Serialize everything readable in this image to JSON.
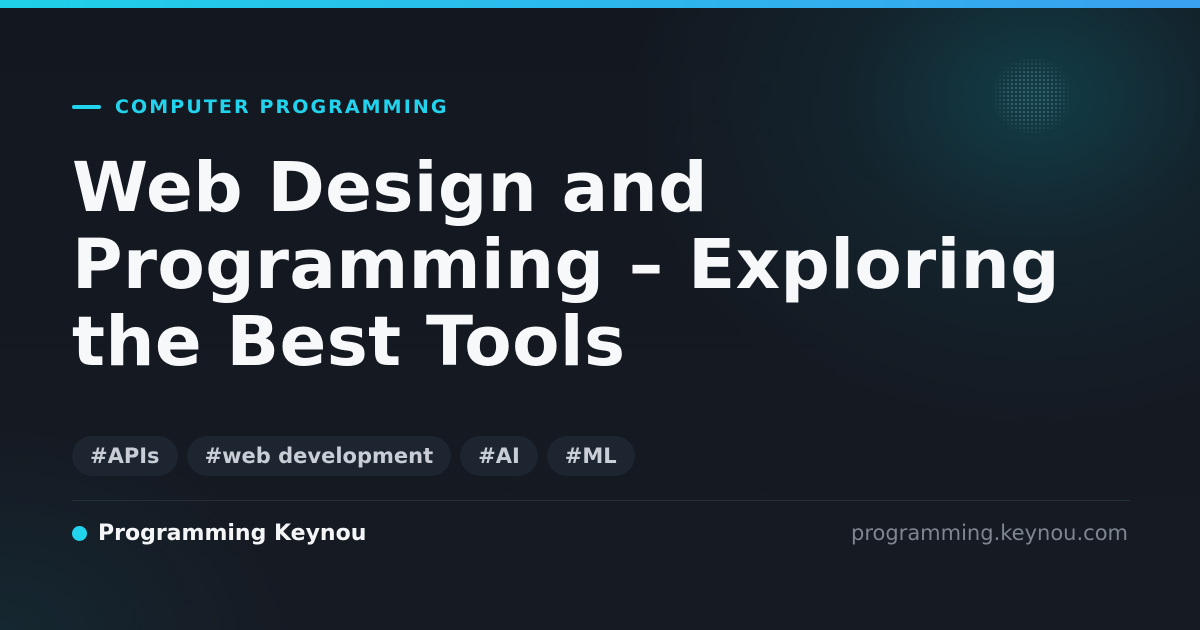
{
  "category": {
    "label": "COMPUTER PROGRAMMING"
  },
  "title": "Web Design and Programming – Exploring the Best Tools",
  "tags": [
    "#APIs",
    "#web development",
    "#AI",
    "#ML"
  ],
  "footer": {
    "brand": "Programming Keynou",
    "url": "programming.keynou.com"
  },
  "colors": {
    "accent": "#22d3ee",
    "background": "#141820",
    "title": "#f7f8fa",
    "tag_background": "#1c2530",
    "muted": "#7e8691"
  }
}
